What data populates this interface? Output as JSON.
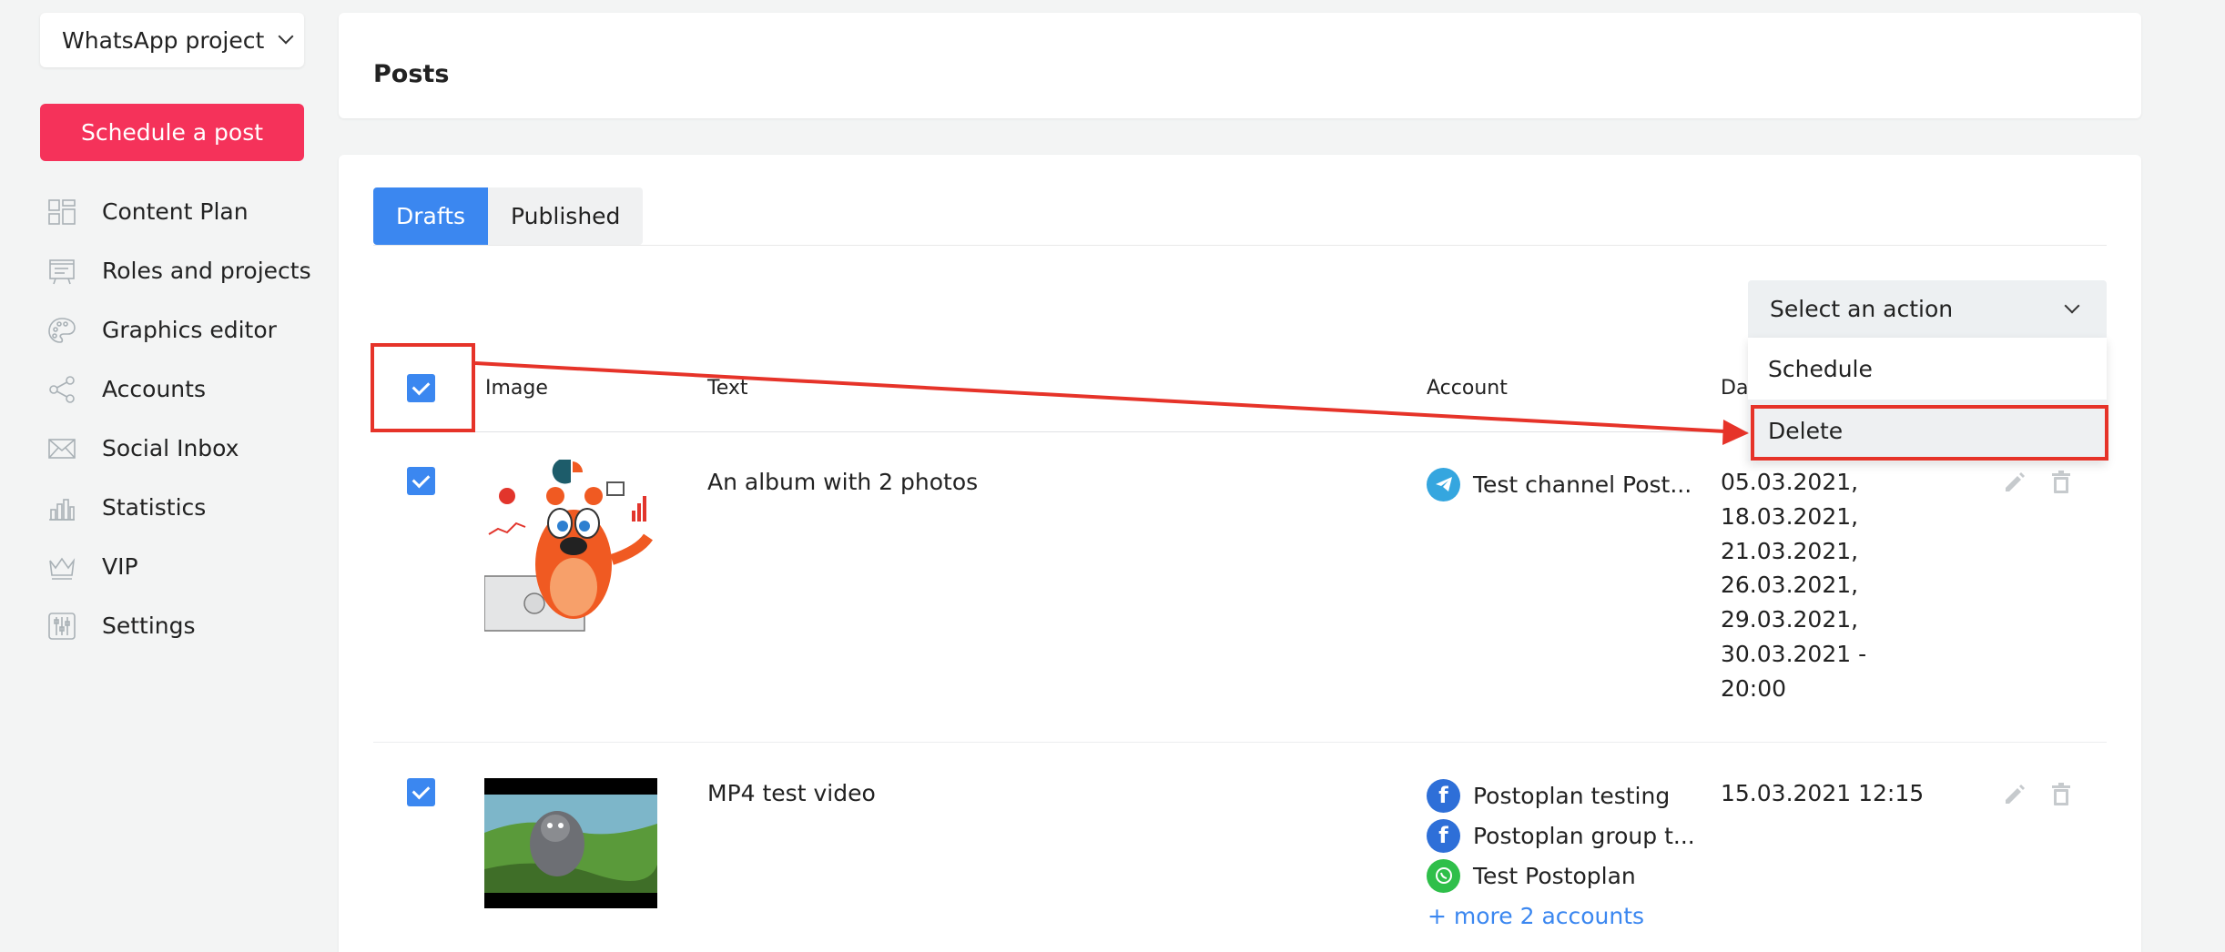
{
  "sidebar": {
    "project": "WhatsApp project",
    "schedule_button": "Schedule a post",
    "items": [
      {
        "label": "Content Plan",
        "icon": "content-plan-icon"
      },
      {
        "label": "Roles and projects",
        "icon": "roles-icon"
      },
      {
        "label": "Graphics editor",
        "icon": "palette-icon"
      },
      {
        "label": "Accounts",
        "icon": "share-icon"
      },
      {
        "label": "Social Inbox",
        "icon": "envelope-icon"
      },
      {
        "label": "Statistics",
        "icon": "bar-chart-icon"
      },
      {
        "label": "VIP",
        "icon": "crown-icon"
      },
      {
        "label": "Settings",
        "icon": "sliders-icon"
      }
    ]
  },
  "header": {
    "title": "Posts"
  },
  "tabs": [
    {
      "label": "Drafts",
      "active": true
    },
    {
      "label": "Published",
      "active": false
    }
  ],
  "action_select": {
    "label": "Select an action",
    "options": [
      "Schedule",
      "Delete"
    ],
    "highlighted": "Delete"
  },
  "table": {
    "headers": [
      "Image",
      "Text",
      "Account",
      "Dat"
    ],
    "rows": [
      {
        "checked": true,
        "text": "An album with 2 photos",
        "accounts": [
          {
            "name": "Test channel Post...",
            "type": "telegram"
          }
        ],
        "dates": [
          "05.03.2021,",
          "18.03.2021,",
          "21.03.2021,",
          "26.03.2021,",
          "29.03.2021,",
          "30.03.2021 -",
          "20:00"
        ]
      },
      {
        "checked": true,
        "text": "MP4 test video",
        "accounts": [
          {
            "name": "Postoplan testing",
            "type": "facebook"
          },
          {
            "name": "Postoplan group t...",
            "type": "facebook"
          },
          {
            "name": "Test Postoplan",
            "type": "whatsapp"
          }
        ],
        "more": "+ more 2 accounts",
        "dates": [
          "15.03.2021 12:15"
        ]
      }
    ]
  },
  "colors": {
    "accent": "#3b87f0",
    "brand": "#f5325a",
    "annotation": "#e63329"
  }
}
